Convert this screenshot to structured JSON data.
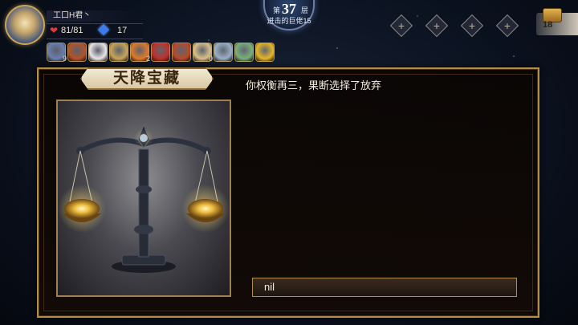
{
  "player": {
    "name": "工口H君丶",
    "hp": "81/81",
    "gems": "17"
  },
  "floor": {
    "prefix": "第",
    "number": "37",
    "suffix": "层",
    "subtitle": "进击的巨佬15"
  },
  "relics": [
    {
      "icon": "dagger-icon",
      "color": "#6a7fb0",
      "count": "9"
    },
    {
      "icon": "shield-emblem-icon",
      "color": "#b5532a",
      "count": ""
    },
    {
      "icon": "scroll-icon",
      "color": "#e8e4ea",
      "count": ""
    },
    {
      "icon": "scales-icon",
      "color": "#c9a55a",
      "count": ""
    },
    {
      "icon": "flower-icon",
      "color": "#e07a2a",
      "count": "2"
    },
    {
      "icon": "red-card-icon",
      "color": "#c2302a",
      "count": ""
    },
    {
      "icon": "teapot-icon",
      "color": "#b84a2a",
      "count": ""
    },
    {
      "icon": "map-icon",
      "color": "#d8c08a",
      "count": "0"
    },
    {
      "icon": "silver-shield-icon",
      "color": "#9ab0c8",
      "count": ""
    },
    {
      "icon": "sword-icon",
      "color": "#7ab07a",
      "count": ""
    },
    {
      "icon": "gold-coin-icon",
      "color": "#e6b528",
      "count": ""
    }
  ],
  "slots": [
    "+",
    "+",
    "+",
    "+"
  ],
  "chest_count": "18",
  "event": {
    "title": "天降宝藏",
    "description": "你权衡再三，果断选择了放弃",
    "option": "nil"
  },
  "colors": {
    "frame_gold": "#b58d4a",
    "panel_bg": "#0e0805",
    "accent_blue": "#3d7be8"
  }
}
